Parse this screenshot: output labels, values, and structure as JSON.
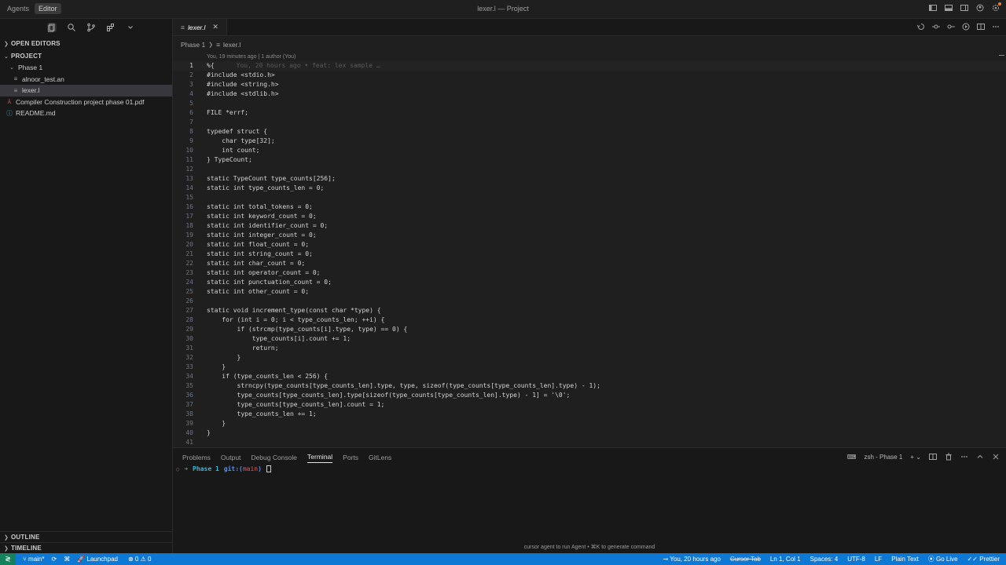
{
  "titlebar": {
    "tabs": [
      "Agents",
      "Editor"
    ],
    "title": "lexer.l — Project"
  },
  "sidebar": {
    "open_editors_label": "OPEN EDITORS",
    "project_label": "PROJECT",
    "tree": [
      {
        "label": "Phase 1",
        "icon": "chevron-down-icon",
        "depth": 1
      },
      {
        "label": "alnoor_test.an",
        "icon": "file-lines-icon",
        "depth": 2
      },
      {
        "label": "lexer.l",
        "icon": "file-lines-icon",
        "depth": 2,
        "selected": true
      },
      {
        "label": "Compiler Construction project phase 01.pdf",
        "icon": "pdf-icon",
        "depth": 1
      },
      {
        "label": "README.md",
        "icon": "info-icon",
        "depth": 1
      }
    ],
    "outline_label": "OUTLINE",
    "timeline_label": "TIMELINE"
  },
  "editor": {
    "tab_label": "lexer.l",
    "breadcrumb": [
      "Phase 1",
      "lexer.l"
    ],
    "blame": "You, 19 minutes ago | 1 author (You)",
    "ghost_blame": "You, 20 hours ago • feat: lex sample …",
    "lines": [
      "%{",
      "#include <stdio.h>",
      "#include <string.h>",
      "#include <stdlib.h>",
      "",
      "FILE *errf;",
      "",
      "typedef struct {",
      "    char type[32];",
      "    int count;",
      "} TypeCount;",
      "",
      "static TypeCount type_counts[256];",
      "static int type_counts_len = 0;",
      "",
      "static int total_tokens = 0;",
      "static int keyword_count = 0;",
      "static int identifier_count = 0;",
      "static int integer_count = 0;",
      "static int float_count = 0;",
      "static int string_count = 0;",
      "static int char_count = 0;",
      "static int operator_count = 0;",
      "static int punctuation_count = 0;",
      "static int other_count = 0;",
      "",
      "static void increment_type(const char *type) {",
      "    for (int i = 0; i < type_counts_len; ++i) {",
      "        if (strcmp(type_counts[i].type, type) == 0) {",
      "            type_counts[i].count += 1;",
      "            return;",
      "        }",
      "    }",
      "    if (type_counts_len < 256) {",
      "        strncpy(type_counts[type_counts_len].type, type, sizeof(type_counts[type_counts_len].type) - 1);",
      "        type_counts[type_counts_len].type[sizeof(type_counts[type_counts_len].type) - 1] = '\\0';",
      "        type_counts[type_counts_len].count = 1;",
      "        type_counts_len += 1;",
      "    }",
      "}",
      ""
    ]
  },
  "panel": {
    "tabs": [
      "Problems",
      "Output",
      "Debug Console",
      "Terminal",
      "Ports",
      "GitLens"
    ],
    "active_tab": "Terminal",
    "terminal_name": "zsh - Phase 1",
    "prompt_arrow": "➜",
    "prompt_dir": "Phase 1",
    "prompt_git": "git:(",
    "prompt_branch": "main",
    "prompt_git_close": ")",
    "agent_hint": "cursor agent to run Agent • ⌘K to generate command"
  },
  "statusbar": {
    "branch": "main*",
    "launchpad": "Launchpad",
    "errors": "0",
    "warnings": "0",
    "blame": "You, 20 hours ago",
    "cursor_tab": "Cursor Tab",
    "position": "Ln 1, Col 1",
    "spaces": "Spaces: 4",
    "encoding": "UTF-8",
    "eol": "LF",
    "language": "Plain Text",
    "go_live": "Go Live",
    "prettier": "Prettier"
  },
  "colors": {
    "statusbar_bg": "#0e78d5",
    "remote_bg": "#16825d",
    "notification_dot": "#e8822e"
  }
}
